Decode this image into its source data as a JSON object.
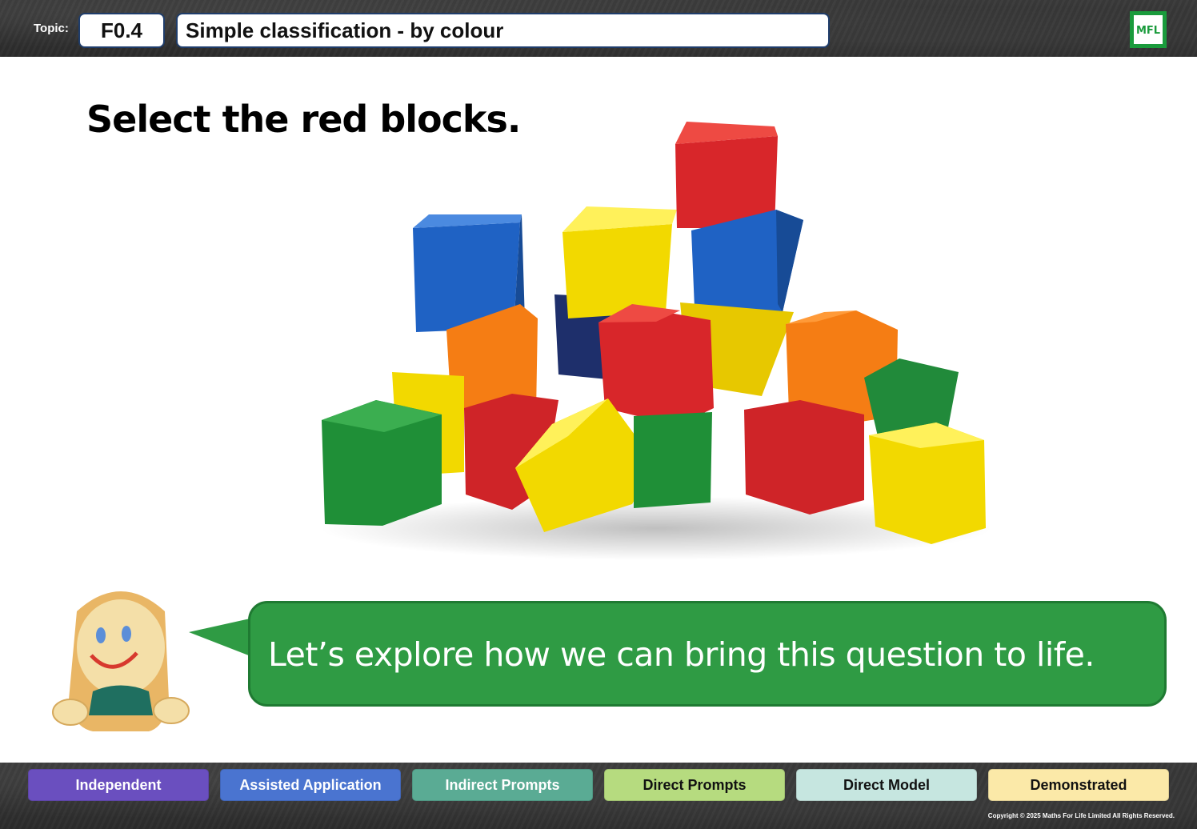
{
  "header": {
    "topic_label": "Topic:",
    "topic_code": "F0.4",
    "topic_title": "Simple classification - by colour",
    "logo_text": "MFL"
  },
  "question": "Select the red blocks.",
  "speech": "Let’s explore how we can bring this question to life.",
  "levels": [
    {
      "label": "Independent",
      "bg": "#6a4fbf",
      "fg": "#ffffff"
    },
    {
      "label": "Assisted Application",
      "bg": "#4a74d0",
      "fg": "#ffffff"
    },
    {
      "label": "Indirect Prompts",
      "bg": "#5aab94",
      "fg": "#ffffff"
    },
    {
      "label": "Direct Prompts",
      "bg": "#b6db7f",
      "fg": "#111111"
    },
    {
      "label": "Direct Model",
      "bg": "#c6e6e0",
      "fg": "#111111"
    },
    {
      "label": "Demonstrated",
      "bg": "#fbe9a8",
      "fg": "#111111"
    }
  ],
  "copyright": "Copyright © 2025 Maths For Life Limited All Rights Reserved.",
  "colors": {
    "bubble": "#2f9b44",
    "header_border": "#1f3d6b",
    "logo_green": "#1a9b3c"
  }
}
